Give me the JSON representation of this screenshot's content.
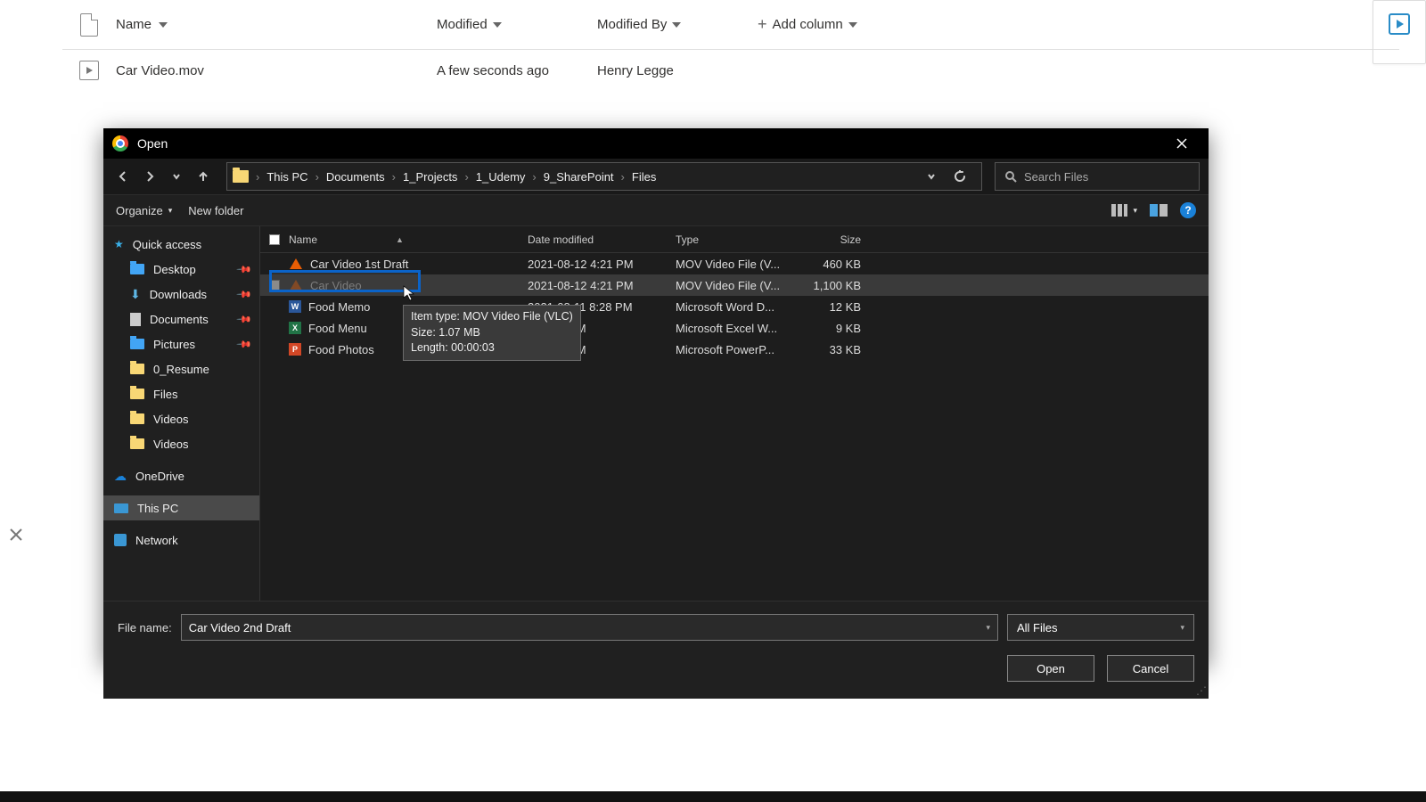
{
  "sharepoint": {
    "columns": {
      "name": "Name",
      "modified": "Modified",
      "modifiedBy": "Modified By",
      "add": "Add column"
    },
    "row": {
      "name": "Car Video.mov",
      "modified": "A few seconds ago",
      "modifiedBy": "Henry Legge"
    }
  },
  "dialog": {
    "title": "Open",
    "breadcrumb": [
      "This PC",
      "Documents",
      "1_Projects",
      "1_Udemy",
      "9_SharePoint",
      "Files"
    ],
    "searchPlaceholder": "Search Files",
    "toolbar": {
      "organize": "Organize",
      "newFolder": "New folder"
    },
    "sidebar": {
      "quickAccess": "Quick access",
      "desktop": "Desktop",
      "downloads": "Downloads",
      "documents": "Documents",
      "pictures": "Pictures",
      "resume": "0_Resume",
      "files": "Files",
      "videos1": "Videos",
      "videos2": "Videos",
      "onedrive": "OneDrive",
      "thispc": "This PC",
      "network": "Network"
    },
    "columns": {
      "name": "Name",
      "date": "Date modified",
      "type": "Type",
      "size": "Size"
    },
    "files": [
      {
        "icon": "vlc",
        "name": "Car Video 1st Draft",
        "date": "2021-08-12 4:21 PM",
        "type": "MOV Video File (V...",
        "size": "460 KB"
      },
      {
        "icon": "vlc",
        "name": "Car Video",
        "date": "2021-08-12 4:21 PM",
        "type": "MOV Video File (V...",
        "size": "1,100 KB"
      },
      {
        "icon": "word",
        "name": "Food Memo",
        "date": "2021-08-11 8:28 PM",
        "type": "Microsoft Word D...",
        "size": "12 KB"
      },
      {
        "icon": "xls",
        "name": "Food Menu",
        "date": "11 8:29 PM",
        "type": "Microsoft Excel W...",
        "size": "9 KB"
      },
      {
        "icon": "ppt",
        "name": "Food Photos",
        "date": "11 8:29 PM",
        "type": "Microsoft PowerP...",
        "size": "33 KB"
      }
    ],
    "tooltip": {
      "line1": "Item type: MOV Video File (VLC)",
      "line2": "Size: 1.07 MB",
      "line3": "Length: 00:00:03"
    },
    "fileNameLabel": "File name:",
    "fileNameValue": "Car Video 2nd Draft",
    "filter": "All Files",
    "openBtn": "Open",
    "cancelBtn": "Cancel"
  }
}
